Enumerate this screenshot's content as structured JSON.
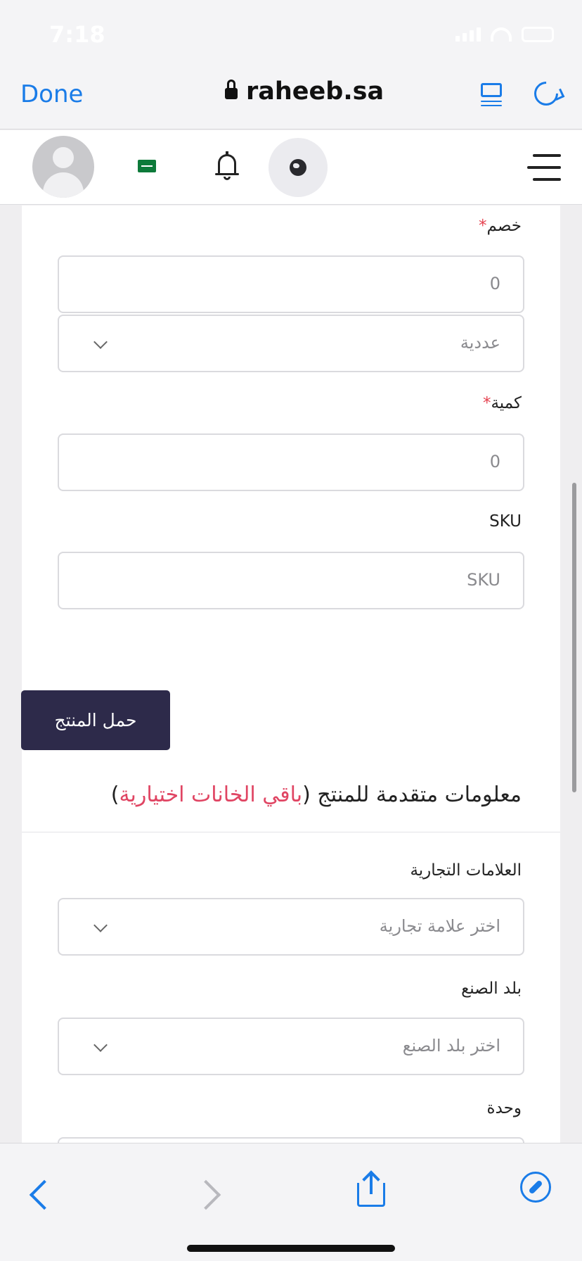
{
  "status_bar": {
    "time": "7:18"
  },
  "browser": {
    "done_label": "Done",
    "url": "raheeb.sa"
  },
  "form": {
    "discount_label": "خصم",
    "required_mark": "*",
    "discount_value": "0",
    "discount_type_value": "عددية",
    "quantity_label": "كمية",
    "quantity_value": "0",
    "sku_label": "SKU",
    "sku_placeholder": "SKU"
  },
  "load_button_label": "حمل المنتج",
  "advanced": {
    "title_main": "معلومات متقدمة للمنتج",
    "title_paren_open": "(",
    "title_highlight": "باقي الخانات اختيارية",
    "title_paren_close": ")",
    "brands_label": "العلامات التجارية",
    "brands_placeholder": "اختر علامة تجارية",
    "origin_label": "بلد الصنع",
    "origin_placeholder": "اختر بلد الصنع",
    "unit_label": "وحدة"
  },
  "colors": {
    "accent": "#1a7ce8",
    "primary_button": "#2d2a4a",
    "highlight": "#e04563",
    "required": "#e5414f"
  }
}
